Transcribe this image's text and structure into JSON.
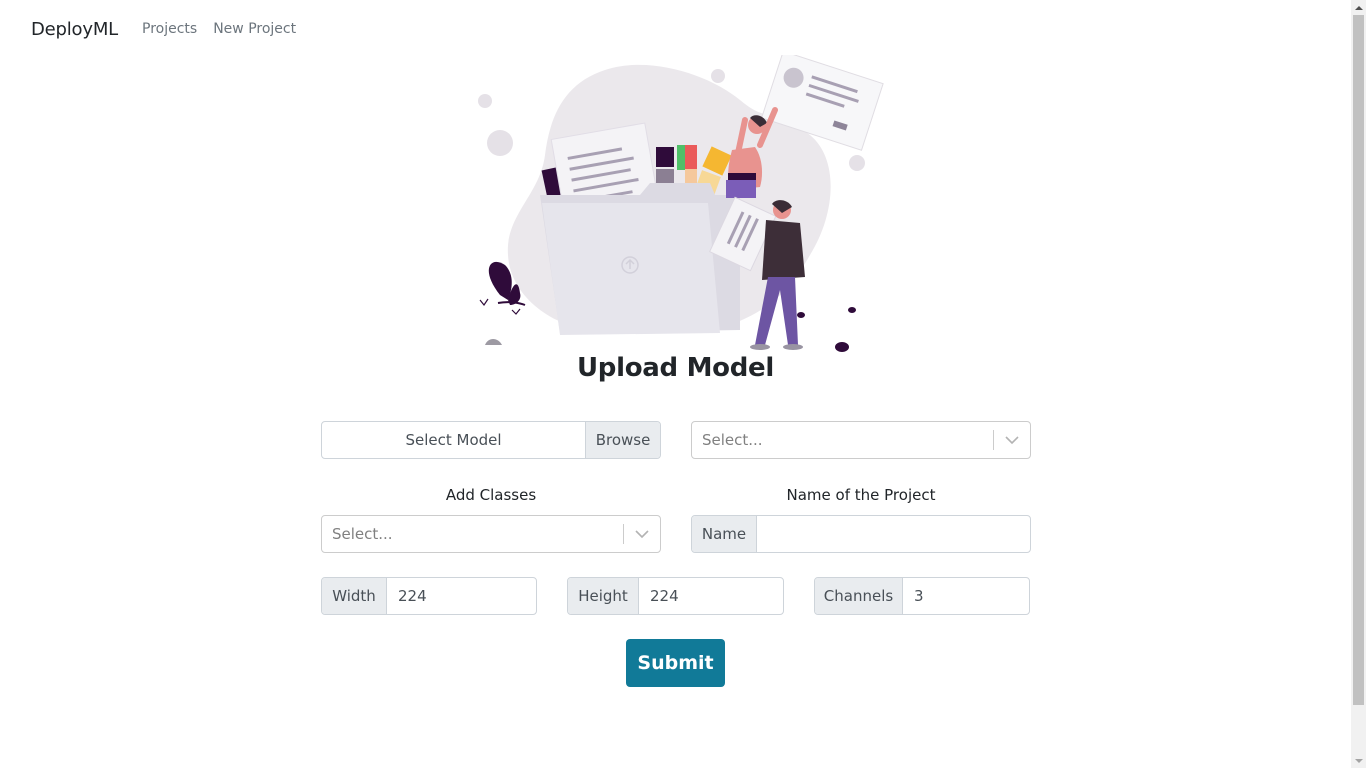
{
  "navbar": {
    "brand": "DeployML",
    "links": [
      "Projects",
      "New Project"
    ]
  },
  "illustration": {
    "name": "upload-folder-illustration"
  },
  "page": {
    "title": "Upload Model"
  },
  "form": {
    "file": {
      "label": "Select Model",
      "browse": "Browse"
    },
    "framework_select": {
      "placeholder": "Select..."
    },
    "classes": {
      "label": "Add Classes",
      "placeholder": "Select..."
    },
    "project_name": {
      "label": "Name of the Project",
      "addon": "Name",
      "value": ""
    },
    "width": {
      "addon": "Width",
      "value": "224"
    },
    "height": {
      "addon": "Height",
      "value": "224"
    },
    "channels": {
      "addon": "Channels",
      "value": "3"
    },
    "submit": "Submit"
  },
  "colors": {
    "primary_button": "#117a98",
    "addon_background": "#e9ecef",
    "accent_dark": "#2f0b3a"
  }
}
